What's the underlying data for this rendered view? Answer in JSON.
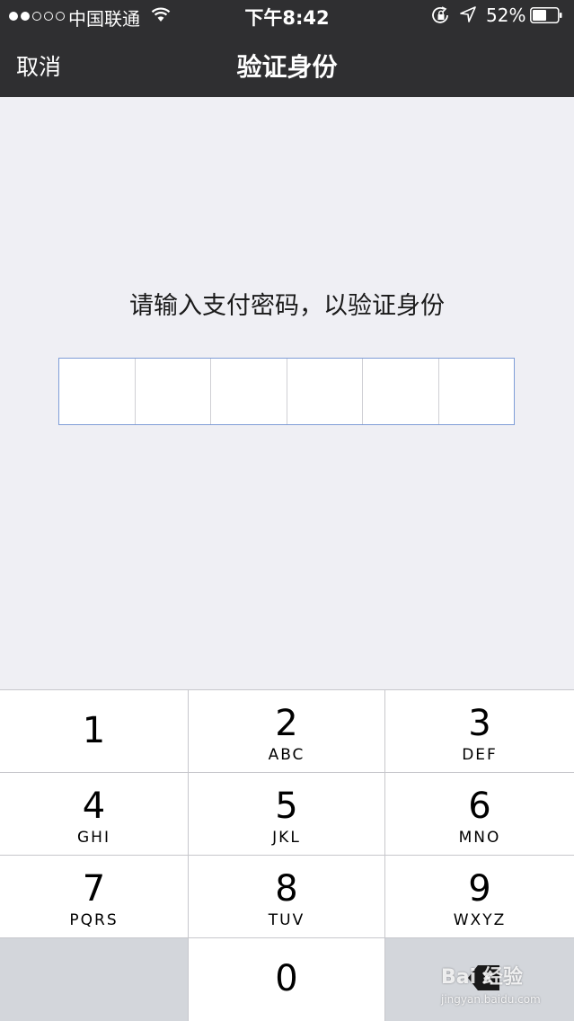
{
  "status_bar": {
    "carrier": "中国联通",
    "time": "下午8:42",
    "battery_percent": "52%",
    "signal_bars_filled": 2,
    "signal_bars_total": 5,
    "icons": [
      "signal-dots-icon",
      "wifi-icon",
      "rotation-lock-icon",
      "location-arrow-icon",
      "battery-icon"
    ]
  },
  "nav_bar": {
    "cancel_label": "取消",
    "title": "验证身份"
  },
  "main": {
    "prompt": "请输入支付密码，以验证身份",
    "pin_length": 6,
    "pin_value": ""
  },
  "keypad": {
    "keys": [
      {
        "digit": "1",
        "letters": ""
      },
      {
        "digit": "2",
        "letters": "ABC"
      },
      {
        "digit": "3",
        "letters": "DEF"
      },
      {
        "digit": "4",
        "letters": "GHI"
      },
      {
        "digit": "5",
        "letters": "JKL"
      },
      {
        "digit": "6",
        "letters": "MNO"
      },
      {
        "digit": "7",
        "letters": "PQRS"
      },
      {
        "digit": "8",
        "letters": "TUV"
      },
      {
        "digit": "9",
        "letters": "WXYZ"
      },
      {
        "digit": "0",
        "letters": ""
      }
    ],
    "delete_icon": "backspace-icon"
  },
  "watermark": {
    "main": "Bai 经验",
    "sub": "jingyan.baidu.com"
  },
  "colors": {
    "topbar_bg": "#2f2f31",
    "page_bg": "#efeff4",
    "pin_border": "#7f9dd7",
    "keypad_dark_key": "#d3d6db"
  }
}
